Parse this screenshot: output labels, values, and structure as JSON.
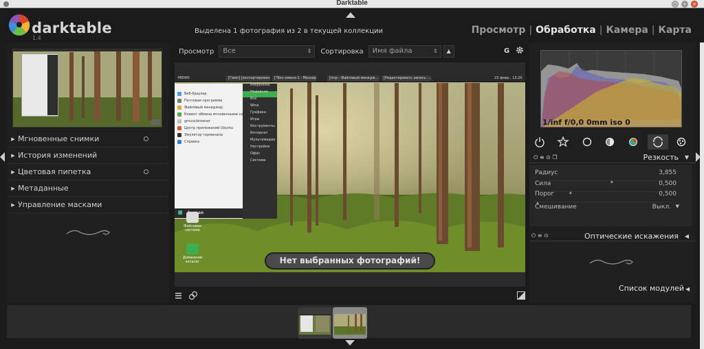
{
  "window": {
    "title": "Darktable"
  },
  "app": {
    "name": "darktable",
    "version": "1.4"
  },
  "header": {
    "selection_info": "Выделена 1 фотография из 2 в текущей коллекции",
    "views": [
      "Просмотр",
      "Обработка",
      "Камера",
      "Карта"
    ],
    "active_view": "Обработка",
    "separator": "|"
  },
  "left_modules": [
    {
      "label": "Мгновенные снимки",
      "has_reset": true
    },
    {
      "label": "История изменений",
      "has_reset": false
    },
    {
      "label": "Цветовая пипетка",
      "has_reset": true
    },
    {
      "label": "Метаданные",
      "has_reset": false
    },
    {
      "label": "Управление масками",
      "has_reset": false
    }
  ],
  "center_toolbar": {
    "view_label": "Просмотр",
    "view_value": "Все",
    "sort_label": "Сортировка",
    "sort_value": "Имя файла",
    "sort_dir": "▲",
    "g_label": "G"
  },
  "image": {
    "no_photo_message": "Нет выбранных фотографий!",
    "taskbar": {
      "menu": "МЕНЮ",
      "tabs": [
        "[Гимп] [экспортирован...",
        "[*Без имени 1 - Mousepad]",
        "[tmp - Файловый менедж...",
        "[Редактировать запись -..."
      ],
      "clock": "23 февр., 13:20"
    },
    "launcher_items": [
      "Веб-браузер",
      "Почтовая программа",
      "Файловый менеджер",
      "Клиент обмена мгновенными соо...",
      "gmusicbrowser",
      "Центр приложений Ubuntu",
      "Эмулятор терминала",
      "Справка"
    ],
    "categories": [
      "Избранное",
      "Недавние",
      "Все",
      "Wine",
      "Графика",
      "Игры",
      "Инструменты",
      "Интернет",
      "Мультимедиа",
      "Настройки",
      "Офис",
      "Система"
    ],
    "user": "human",
    "desktop_icons": [
      "Файловая система",
      "Домашний каталог"
    ]
  },
  "histogram": {
    "exif": "1/inf f/0,0 0mm iso 0"
  },
  "module_sharpen": {
    "title": "Резкость",
    "sliders": [
      {
        "label": "Радиус",
        "value": "3,855",
        "level": 0.55
      },
      {
        "label": "Сила",
        "value": "0,500",
        "level": 0.25
      },
      {
        "label": "Порог",
        "value": "0,500",
        "level": 0.01
      }
    ],
    "blend_label": "Смешивание",
    "blend_value": "Выкл."
  },
  "module_lens": {
    "title": "Оптические искажения"
  },
  "module_list": {
    "label": "Список модулей"
  },
  "colors": {
    "accent_logo": [
      "#d8472b",
      "#f3b23a",
      "#6bbf4b",
      "#3f8fd8",
      "#8a54b8"
    ],
    "highlight": "#3fae4f"
  }
}
